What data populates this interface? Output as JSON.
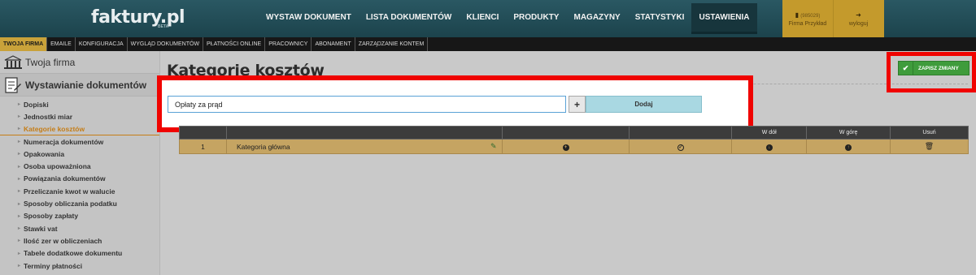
{
  "brand": {
    "logo": "faktury.pl",
    "beta": "BETA"
  },
  "main_nav": [
    {
      "label": "WYSTAW DOKUMENT"
    },
    {
      "label": "LISTA DOKUMENTÓW"
    },
    {
      "label": "KLIENCI"
    },
    {
      "label": "PRODUKTY"
    },
    {
      "label": "MAGAZYNY"
    },
    {
      "label": "STATYSTYKI"
    },
    {
      "label": "USTAWIENIA",
      "active": true
    }
  ],
  "account": {
    "id": "(985029)",
    "company": "Firma Przykład",
    "logout": "wyloguj"
  },
  "sub_nav": [
    {
      "label": "TWOJA FIRMA",
      "active": true
    },
    {
      "label": "EMAILE"
    },
    {
      "label": "KONFIGURACJA"
    },
    {
      "label": "WYGLĄD DOKUMENTÓW"
    },
    {
      "label": "PŁATNOŚCI ONLINE"
    },
    {
      "label": "PRACOWNICY"
    },
    {
      "label": "ABONAMENT"
    },
    {
      "label": "ZARZĄDZANIE KONTEM"
    }
  ],
  "sidebar": {
    "sections": [
      {
        "title": "Twoja firma",
        "icon": "bank-icon"
      },
      {
        "title": "Wystawianie dokumentów",
        "icon": "document-edit-icon"
      }
    ],
    "items": [
      {
        "label": "Dopiski"
      },
      {
        "label": "Jednostki miar"
      },
      {
        "label": "Kategorie kosztów",
        "active": true
      },
      {
        "label": "Numeracja dokumentów"
      },
      {
        "label": "Opakowania"
      },
      {
        "label": "Osoba upoważniona"
      },
      {
        "label": "Powiązania dokumentów"
      },
      {
        "label": "Przeliczanie kwot w walucie"
      },
      {
        "label": "Sposoby obliczania podatku"
      },
      {
        "label": "Sposoby zapłaty"
      },
      {
        "label": "Stawki vat"
      },
      {
        "label": "Ilość zer w obliczeniach"
      },
      {
        "label": "Tabele dodatkowe dokumentu"
      },
      {
        "label": "Terminy płatności"
      }
    ]
  },
  "page": {
    "title": "Kategorie kosztów",
    "save_label": "ZAPISZ ZMIANY",
    "input_value": "Opłaty za prąd",
    "add_plus": "+",
    "add_label": "Dodaj"
  },
  "table": {
    "headers": [
      "",
      "",
      "",
      "",
      "W dół",
      "W górę",
      "Usuń"
    ],
    "rows": [
      {
        "num": "1",
        "name": "Kategoria główna"
      }
    ]
  },
  "colors": {
    "accent": "#c57d17",
    "header_bg": "#1c434c",
    "highlight_border": "#f00300",
    "save_green": "#3f9c3c"
  }
}
